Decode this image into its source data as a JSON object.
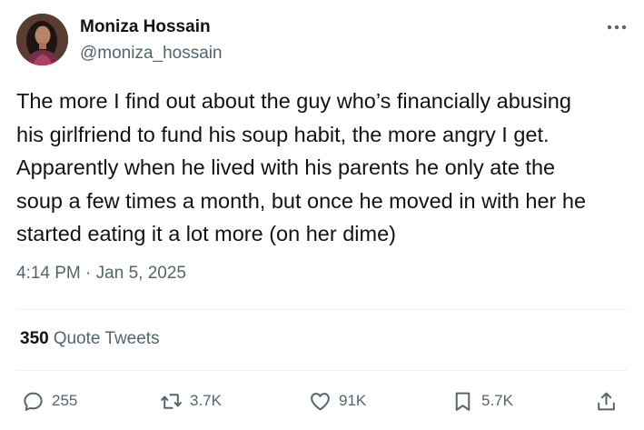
{
  "author": {
    "name": "Moniza Hossain",
    "handle": "@moniza_hossain"
  },
  "tweet": {
    "text": "The more I find out about the guy who’s financially abusing\nhis girlfriend to fund his soup habit, the more angry I get.\nApparently when he lived with his parents he only ate the\nsoup a few times a month, but once he moved in with her he\nstarted eating it a lot more (on her dime)",
    "time": "4:14 PM",
    "separator": "·",
    "date": "Jan 5, 2025"
  },
  "quote_tweets": {
    "count": "350",
    "label": "Quote Tweets"
  },
  "actions": {
    "replies": "255",
    "retweets": "3.7K",
    "likes": "91K",
    "bookmarks": "5.7K"
  },
  "icons": {
    "more": "more-horizontal-icon",
    "reply": "reply-icon",
    "retweet": "retweet-icon",
    "like": "heart-icon",
    "bookmark": "bookmark-icon",
    "share": "share-icon"
  },
  "colors": {
    "text": "#0f1419",
    "secondary": "#536471",
    "divider": "#eff3f4"
  }
}
